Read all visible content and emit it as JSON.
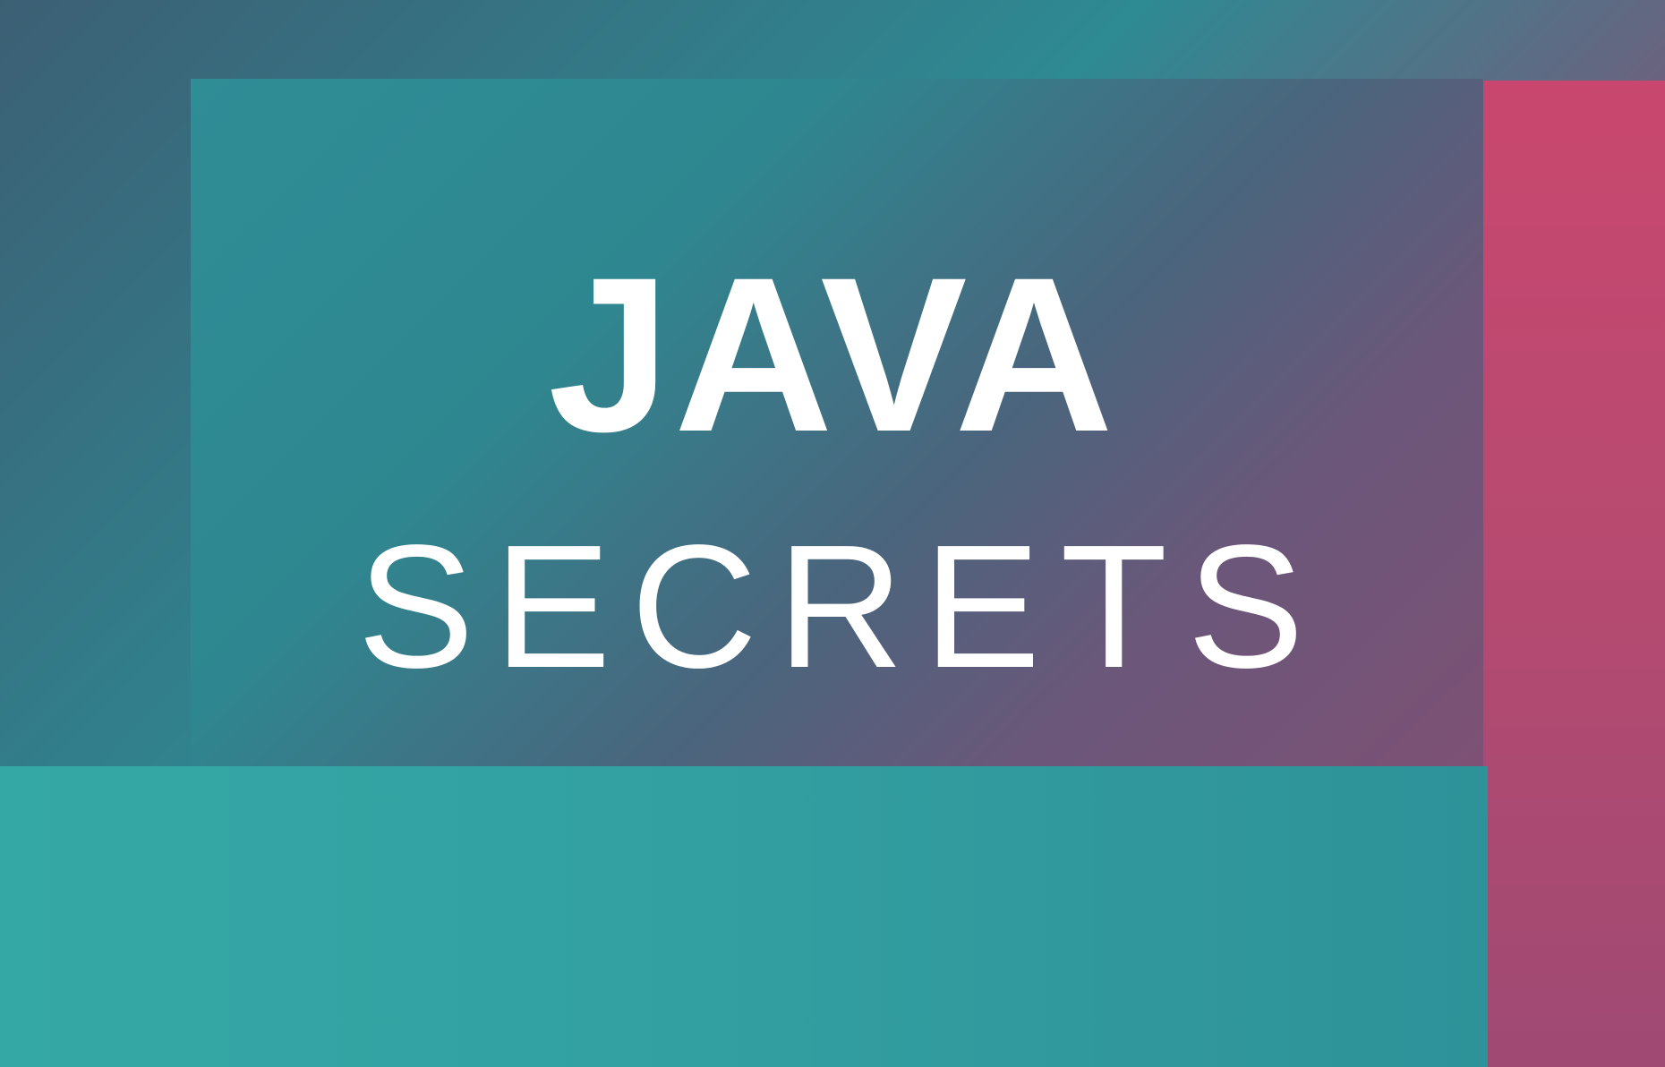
{
  "cover": {
    "title": "JAVA",
    "subtitle": "SECRETS",
    "colors": {
      "teal": "#2e8f95",
      "teal_light": "#34a8a5",
      "slate": "#4f6377",
      "magenta": "#d2426f",
      "text": "#ffffff"
    }
  }
}
